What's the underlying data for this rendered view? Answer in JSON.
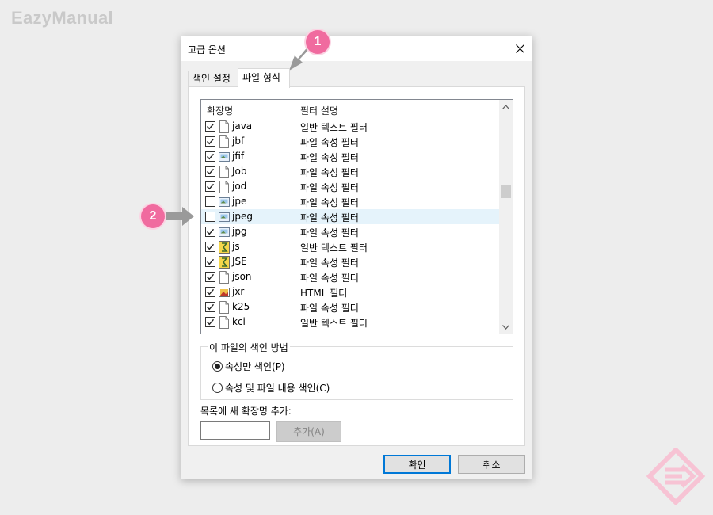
{
  "watermark": "EazyManual",
  "dialog": {
    "title": "고급 옵션",
    "tabs": [
      {
        "label": "색인 설정",
        "active": false
      },
      {
        "label": "파일 형식",
        "active": true
      }
    ],
    "list": {
      "headers": {
        "ext": "확장명",
        "desc": "필터 설명"
      },
      "rows": [
        {
          "ext": "java",
          "desc": "일반 텍스트 필터",
          "checked": true,
          "icon": "file-blank-icon"
        },
        {
          "ext": "jbf",
          "desc": "파일 속성 필터",
          "checked": true,
          "icon": "file-blank-icon"
        },
        {
          "ext": "jfif",
          "desc": "파일 속성 필터",
          "checked": true,
          "icon": "image-file-icon"
        },
        {
          "ext": "Job",
          "desc": "파일 속성 필터",
          "checked": true,
          "icon": "file-blank-icon"
        },
        {
          "ext": "jod",
          "desc": "파일 속성 필터",
          "checked": true,
          "icon": "file-blank-icon"
        },
        {
          "ext": "jpe",
          "desc": "파일 속성 필터",
          "checked": false,
          "icon": "image-file-icon"
        },
        {
          "ext": "jpeg",
          "desc": "파일 속성 필터",
          "checked": false,
          "icon": "image-file-icon",
          "selected": true
        },
        {
          "ext": "jpg",
          "desc": "파일 속성 필터",
          "checked": true,
          "icon": "image-file-icon"
        },
        {
          "ext": "js",
          "desc": "일반 텍스트 필터",
          "checked": true,
          "icon": "script-file-icon"
        },
        {
          "ext": "JSE",
          "desc": "파일 속성 필터",
          "checked": true,
          "icon": "script-file-icon"
        },
        {
          "ext": "json",
          "desc": "파일 속성 필터",
          "checked": true,
          "icon": "file-blank-icon"
        },
        {
          "ext": "jxr",
          "desc": "HTML 필터",
          "checked": true,
          "icon": "photo-file-icon"
        },
        {
          "ext": "k25",
          "desc": "파일 속성 필터",
          "checked": true,
          "icon": "file-blank-icon"
        },
        {
          "ext": "kci",
          "desc": "일반 텍스트 필터",
          "checked": true,
          "icon": "file-blank-icon"
        }
      ]
    },
    "index_method": {
      "legend": "이 파일의 색인 방법",
      "options": [
        {
          "label": "속성만 색인(P)",
          "selected": true
        },
        {
          "label": "속성 및 파일 내용 색인(C)",
          "selected": false
        }
      ]
    },
    "add_extension": {
      "label": "목록에 새 확장명 추가:",
      "input_value": "",
      "button_label": "추가(A)"
    },
    "ok_label": "확인",
    "cancel_label": "취소"
  },
  "callouts": [
    {
      "number": "1"
    },
    {
      "number": "2"
    }
  ],
  "colors": {
    "badge": "#f06b9f",
    "selection": "#e5f3fb",
    "default_button_border": "#0078d7"
  }
}
